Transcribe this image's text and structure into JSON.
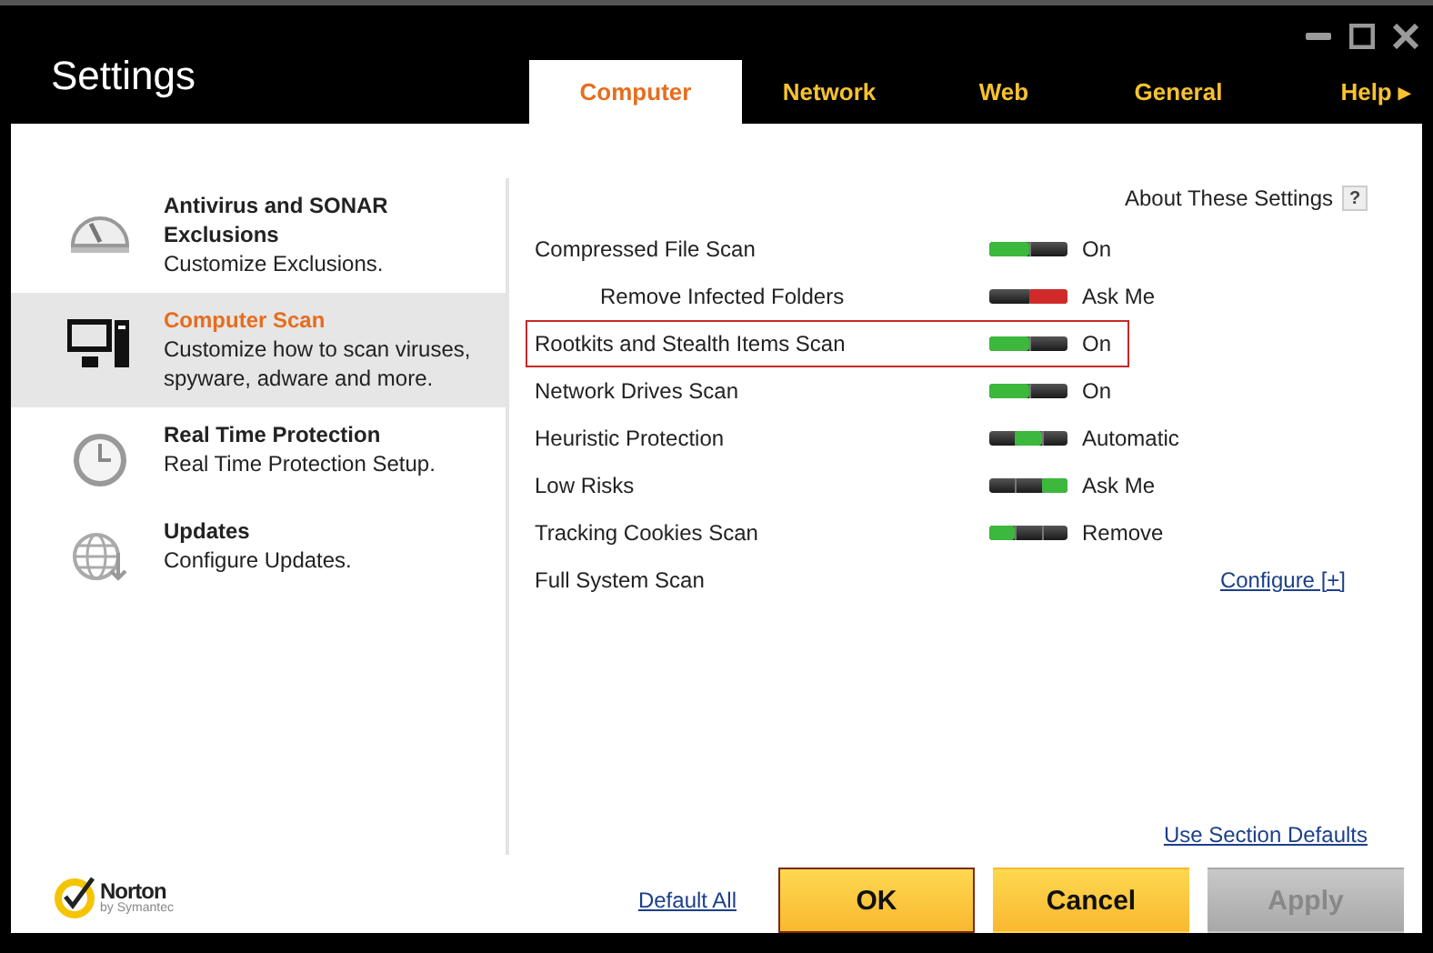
{
  "window": {
    "title": "Settings"
  },
  "tabs": [
    {
      "label": "Computer",
      "selected": true
    },
    {
      "label": "Network",
      "selected": false
    },
    {
      "label": "Web",
      "selected": false
    },
    {
      "label": "General",
      "selected": false
    },
    {
      "label": "Help ▸",
      "selected": false
    }
  ],
  "sidebar": {
    "items": [
      {
        "kind": "gauge",
        "title": "Antivirus and SONAR Exclusions",
        "subtitle": "Customize Exclusions.",
        "selected": false
      },
      {
        "kind": "computer",
        "title": "Computer Scan",
        "subtitle": "Customize how to scan viruses, spyware, adware and more.",
        "selected": true
      },
      {
        "kind": "clock",
        "title": "Real Time Protection",
        "subtitle": "Real Time Protection Setup.",
        "selected": false
      },
      {
        "kind": "globe",
        "title": "Updates",
        "subtitle": "Configure Updates.",
        "selected": false
      }
    ]
  },
  "about": {
    "label": "About These Settings",
    "help": "?"
  },
  "settings": [
    {
      "kind": "two_way",
      "label": "Compressed File Scan",
      "indent": false,
      "highlighted": false,
      "level": 0,
      "color": "#3cb83c",
      "value": "On"
    },
    {
      "kind": "two_way",
      "label": "Remove Infected Folders",
      "indent": true,
      "highlighted": false,
      "level": 1,
      "color": "#d02a2a",
      "value": "Ask Me"
    },
    {
      "kind": "two_way",
      "label": "Rootkits and Stealth Items Scan",
      "indent": false,
      "highlighted": true,
      "level": 0,
      "color": "#3cb83c",
      "value": "On"
    },
    {
      "kind": "two_way",
      "label": "Network Drives Scan",
      "indent": false,
      "highlighted": false,
      "level": 0,
      "color": "#3cb83c",
      "value": "On"
    },
    {
      "kind": "three_way",
      "label": "Heuristic Protection",
      "indent": false,
      "highlighted": false,
      "level": 0.5,
      "color": "#3cb83c",
      "value": "Automatic"
    },
    {
      "kind": "three_way",
      "label": "Low Risks",
      "indent": false,
      "highlighted": false,
      "level": 1,
      "color": "#3cb83c",
      "value": "Ask Me"
    },
    {
      "kind": "three_way",
      "label": "Tracking Cookies Scan",
      "indent": false,
      "highlighted": false,
      "level": 0,
      "color": "#3cb83c",
      "value": "Remove"
    },
    {
      "kind": "link",
      "label": "Full System Scan",
      "indent": false,
      "highlighted": false,
      "value": "Configure [+]"
    }
  ],
  "section_defaults": "Use Section Defaults",
  "footer": {
    "logo": {
      "name": "Norton",
      "tagline": "by Symantec"
    },
    "default_all": "Default All",
    "buttons": [
      {
        "label": "OK",
        "focused": true,
        "disabled": false
      },
      {
        "label": "Cancel",
        "focused": false,
        "disabled": false
      },
      {
        "label": "Apply",
        "focused": false,
        "disabled": true
      }
    ]
  }
}
